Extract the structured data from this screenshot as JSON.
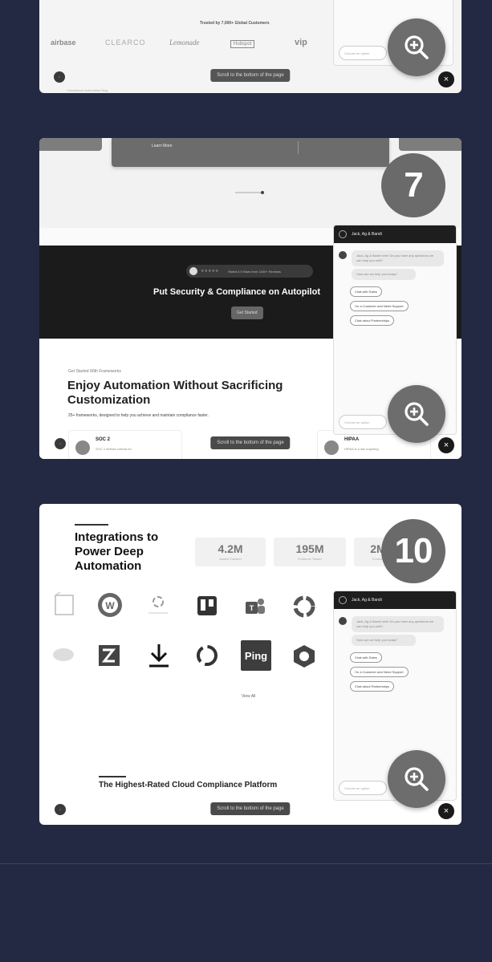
{
  "screenshot1": {
    "trusted_text": "Trusted by 7,000+ Global Customers",
    "logos": [
      "airbase",
      "CLEARCO",
      "Lemonade",
      "Hubspot",
      "vip"
    ],
    "scroll_label": "Scroll to the bottom of the page",
    "chat_placeholder": "Choose an option",
    "footer_link": "Compliance Automation Blog",
    "close": "×"
  },
  "screenshot2": {
    "badge_number": "7",
    "learn_more": "Learn More",
    "banner_reviews": "Rated 4.9 Stars from 1000+ Reviews",
    "banner_title": "Put Security & Compliance on Autopilot",
    "banner_button": "Get Started",
    "eyebrow": "Get Started With Frameworks",
    "heading_line1": "Enjoy Automation Without Sacrificing",
    "heading_line2": "Customization",
    "subtext": "25+ frameworks, designed to help you achieve and maintain compliance faster.",
    "cards": [
      {
        "title": "SOC 2",
        "desc": "SOC 2 defines criteria for"
      },
      {
        "title": "HIPAA",
        "desc": "HIPAA is a law requiring"
      }
    ],
    "chat": {
      "title": "Jack, Ag & Bandi",
      "bubble": "Jack, Ag & Bandi here! Do you have any questions we can help you with?",
      "bubble2": "How can we help you today?",
      "options": [
        "Chat with Sales",
        "I'm a Customer and Need Support",
        "Chat about Partnerships"
      ],
      "placeholder": "Choose an option"
    },
    "scroll_label": "Scroll to the bottom of the page",
    "close": "×"
  },
  "screenshot3": {
    "badge_number": "10",
    "heading": [
      "Integrations to",
      "Power Deep",
      "Automation"
    ],
    "stats": [
      {
        "value": "4.2M",
        "label": "Assets Tracked"
      },
      {
        "value": "195M",
        "label": "Evidence Tested"
      },
      {
        "value": "2M",
        "label": "Controls"
      }
    ],
    "ping_label": "Ping",
    "view_all": "View All",
    "bottom_title": "The Highest-Rated Cloud Compliance Platform",
    "chat": {
      "title": "Jack, Ag & Bandi",
      "bubble": "Jack, Ag & Bandi here! Do you have any questions we can help you with?",
      "bubble2": "How can we help you today?",
      "options": [
        "Chat with Sales",
        "I'm a Customer and Need Support",
        "Chat about Partnerships"
      ],
      "placeholder": "Choose an option"
    },
    "scroll_label": "Scroll to the bottom of the page",
    "close": "×"
  },
  "colors": {
    "page_background": "#242943",
    "zoom_button": "#6d6d6d",
    "banner_dark": "#1b1b1b"
  },
  "icons": [
    "zoom-in-icon",
    "close-icon",
    "chat-avatar-icon",
    "download-icon"
  ]
}
